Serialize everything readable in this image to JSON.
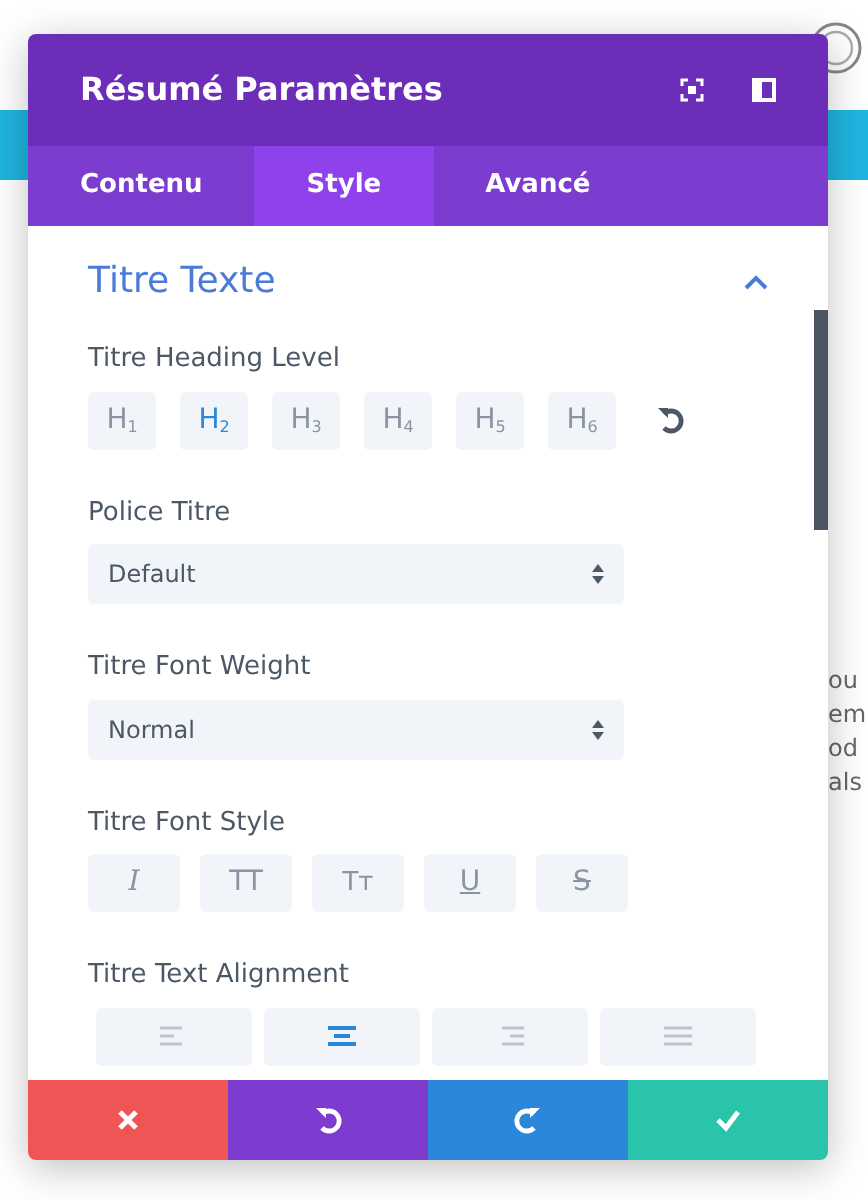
{
  "window": {
    "title": "Résumé Paramètres"
  },
  "tabs": [
    {
      "label": "Contenu",
      "selected": false
    },
    {
      "label": "Style",
      "selected": true
    },
    {
      "label": "Avancé",
      "selected": false
    }
  ],
  "section": {
    "title": "Titre Texte",
    "expanded": true
  },
  "heading_level": {
    "label": "Titre Heading Level",
    "options": [
      {
        "label": "H$_{1}$",
        "selected": false
      },
      {
        "label": "H$_{2}$",
        "selected": true
      },
      {
        "label": "H$_{3}$",
        "selected": false
      },
      {
        "label": "H$_{4}$",
        "selected": false
      },
      {
        "label": "H$_{5}$",
        "selected": false
      },
      {
        "label": "H$_{6}$",
        "selected": false
      }
    ]
  },
  "fields": [
    {
      "kind": "select",
      "label": "Police Titre",
      "value": "Default"
    },
    {
      "kind": "select",
      "label": "Titre Font Weight",
      "value": "Normal"
    },
    {
      "kind": "styles",
      "label": "Titre Font Style",
      "options": [
        {
          "label": "I",
          "selected": false
        },
        {
          "label": "TT",
          "selected": false
        },
        {
          "label": "Tᴛ",
          "selected": false
        },
        {
          "label": "U",
          "selected": false
        },
        {
          "label": "S",
          "selected": false
        }
      ]
    },
    {
      "kind": "align",
      "label": "Titre Text Alignment",
      "options": [
        {
          "selected": false
        },
        {
          "selected": true
        },
        {
          "selected": false
        },
        {
          "selected": false
        }
      ]
    }
  ],
  "footer": [
    {
      "kind": "cancel"
    },
    {
      "kind": "undo"
    },
    {
      "kind": "redo"
    },
    {
      "kind": "save"
    }
  ],
  "background_text": [
    "ou",
    "em",
    "od",
    "als"
  ]
}
